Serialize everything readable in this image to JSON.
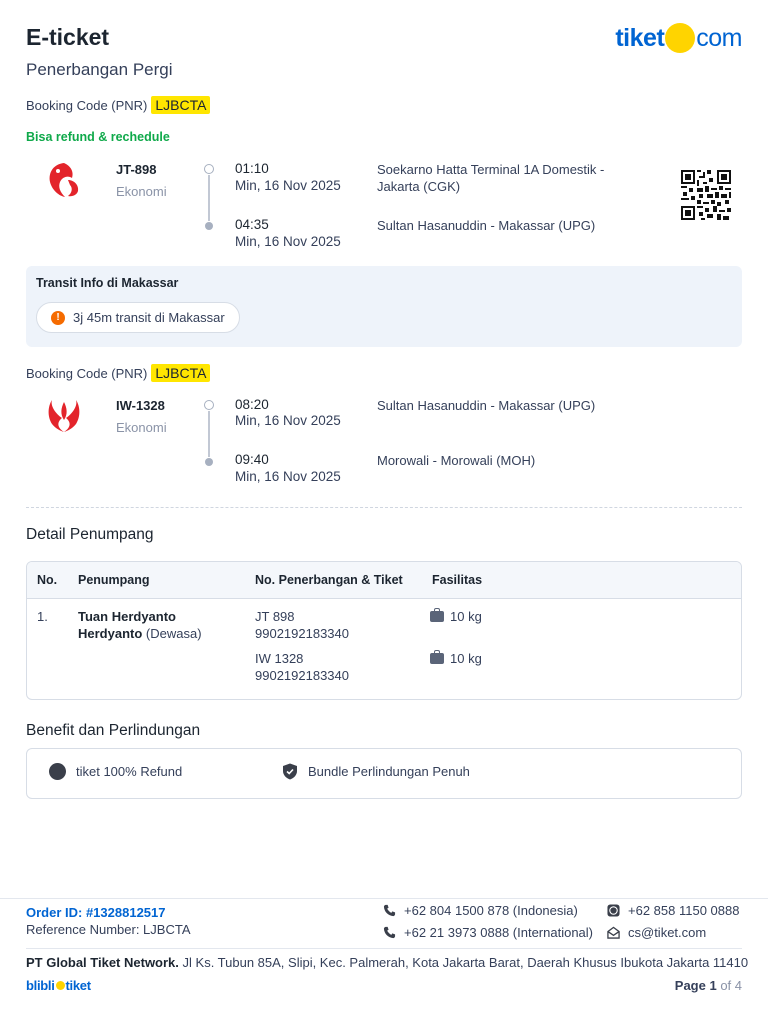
{
  "header": {
    "title": "E-ticket",
    "subtitle": "Penerbangan Pergi",
    "logo_left": "tiket",
    "logo_right": "com"
  },
  "booking1": {
    "label": "Booking Code (PNR)",
    "code": "LJBCTA",
    "refund_note": "Bisa refund & rechedule"
  },
  "flight1": {
    "number": "JT-898",
    "cabin": "Ekonomi",
    "dep_time": "01:10",
    "dep_date": "Min, 16 Nov 2025",
    "dep_place": "Soekarno Hatta Terminal 1A Domestik - Jakarta (CGK)",
    "arr_time": "04:35",
    "arr_date": "Min, 16 Nov 2025",
    "arr_place": "Sultan Hasanuddin - Makassar (UPG)",
    "logo_icon": "lion-air-logo-icon",
    "logo_color": "#e3242b"
  },
  "transit": {
    "title": "Transit Info di Makassar",
    "duration": "3j 45m transit di Makassar",
    "icon": "!"
  },
  "booking2": {
    "label": "Booking Code (PNR)",
    "code": "LJBCTA"
  },
  "flight2": {
    "number": "IW-1328",
    "cabin": "Ekonomi",
    "dep_time": "08:20",
    "dep_date": "Min, 16 Nov 2025",
    "dep_place": "Sultan Hasanuddin - Makassar (UPG)",
    "arr_time": "09:40",
    "arr_date": "Min, 16 Nov 2025",
    "arr_place": "Morowali - Morowali (MOH)",
    "logo_icon": "wings-air-logo-icon",
    "logo_color": "#e3242b"
  },
  "passengers": {
    "section_title": "Detail Penumpang",
    "headers": {
      "no": "No.",
      "name": "Penumpang",
      "flight_ticket": "No. Penerbangan & Tiket",
      "facilities": "Fasilitas"
    },
    "rows": [
      {
        "no": "1.",
        "name_line1": "Tuan Herdyanto",
        "name_line2": "Herdyanto",
        "type": "(Dewasa)",
        "flight1": "JT 898",
        "ticket1": "9902192183340",
        "baggage1": "10 kg",
        "flight2": "IW 1328",
        "ticket2": "9902192183340",
        "baggage2": "10 kg"
      }
    ]
  },
  "benefit": {
    "section_title": "Benefit dan Perlindungan",
    "item1": "tiket 100% Refund",
    "item2": "Bundle Perlindungan Penuh"
  },
  "footer": {
    "order_id": "Order ID: #1328812517",
    "reference": "Reference Number: LJBCTA",
    "phone_id": "+62 804 1500 878 (Indonesia)",
    "phone_intl": "+62 21 3973 0888 (International)",
    "whatsapp": "+62 858 1150 0888",
    "email": "cs@tiket.com",
    "company_name": "PT Global Tiket Network.",
    "company_address": " Jl Ks. Tubun 85A, Slipi, Kec. Palmerah, Kota Jakarta Barat, Daerah Khusus Ibukota Jakarta 11410",
    "brand_left": "blibli",
    "brand_right": "tiket",
    "page_label": "Page 1",
    "page_total": " of 4"
  },
  "colors": {
    "brand_blue": "#0064d2",
    "brand_yellow": "#ffd400",
    "pnr_highlight": "#ffe600",
    "refund_green": "#0fa94a",
    "warning_orange": "#f56b00"
  }
}
